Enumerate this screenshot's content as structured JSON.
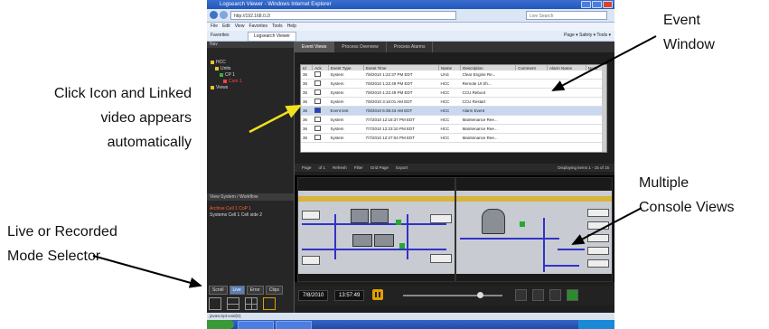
{
  "callouts": {
    "event_window": [
      "Event",
      "Window"
    ],
    "click_icon": [
      "Click Icon and Linked",
      "video appears",
      "automatically"
    ],
    "multiple_console": [
      "Multiple",
      "Console Views"
    ],
    "live_recorded": [
      "Live or Recorded",
      "Mode Selector"
    ]
  },
  "browser": {
    "title": "Logsearch Viewer - Windows Internet Explorer",
    "url": "http://192.168.0.2/",
    "search_placeholder": "Live Search",
    "menu": [
      "File",
      "Edit",
      "View",
      "Favorites",
      "Tools",
      "Help"
    ],
    "favorites_label": "Favorites",
    "tab_label": "Logsearch Viewer",
    "tools_label": "Page ▾ Safety ▾ Tools ▾"
  },
  "app": {
    "left_header": "Nav",
    "tree": [
      "HCC",
      "Units",
      "CP 1",
      "Cam 1",
      "Views"
    ],
    "nav_header": "View System / Workflow",
    "nav_items": [
      "Archive  Cell 1  CoP 1",
      "Systems  Cell 1  Cell side 2"
    ],
    "mode_buttons": [
      "Scroll",
      "Live",
      "Error",
      "Clips"
    ],
    "tabs": [
      "Event Views",
      "Process Overview",
      "Process Alarms"
    ],
    "columns": [
      "Id",
      "Ack",
      "Event Type",
      "Event Time",
      "Name",
      "Description",
      "Comment",
      "Alarm Name",
      "Node"
    ],
    "rows": [
      [
        "36",
        "System",
        "7/8/2010 1:22:37 PM EDT",
        "UAS",
        "Clear Engine Re..."
      ],
      [
        "36",
        "System",
        "7/8/2010 1:22:49 PM EDT",
        "HCC",
        "Remote UI Sh..."
      ],
      [
        "36",
        "System",
        "7/8/2010 1:22:49 PM EDT",
        "HCC",
        "CCU Reboot"
      ],
      [
        "36",
        "System",
        "7/8/2010 3:16:01 AM EDT",
        "HCC",
        "CCU Restart"
      ],
      [
        "36",
        "Event test",
        "7/8/2010 6:38:43 AM EDT",
        "HCC",
        "Alarm Event"
      ],
      [
        "36",
        "System",
        "7/7/2010 12:18:37 PM EDT",
        "HCC",
        "Maintenance Ree..."
      ],
      [
        "36",
        "System",
        "7/7/2010 12:23:10 PM EDT",
        "HCC",
        "Maintenance Ree..."
      ],
      [
        "36",
        "System",
        "7/7/2010 12:27:04 PM EDT",
        "HCC",
        "Maintenance Ree..."
      ]
    ],
    "pager": [
      "Page",
      "of 1",
      "Refresh",
      "Filter",
      "Grid Page",
      "Export"
    ],
    "pager_summary": "Displaying items 1 - 15 of 15",
    "date": "7/8/2010",
    "time": "13:57:49"
  },
  "statusbar": "javascript:void(0);"
}
